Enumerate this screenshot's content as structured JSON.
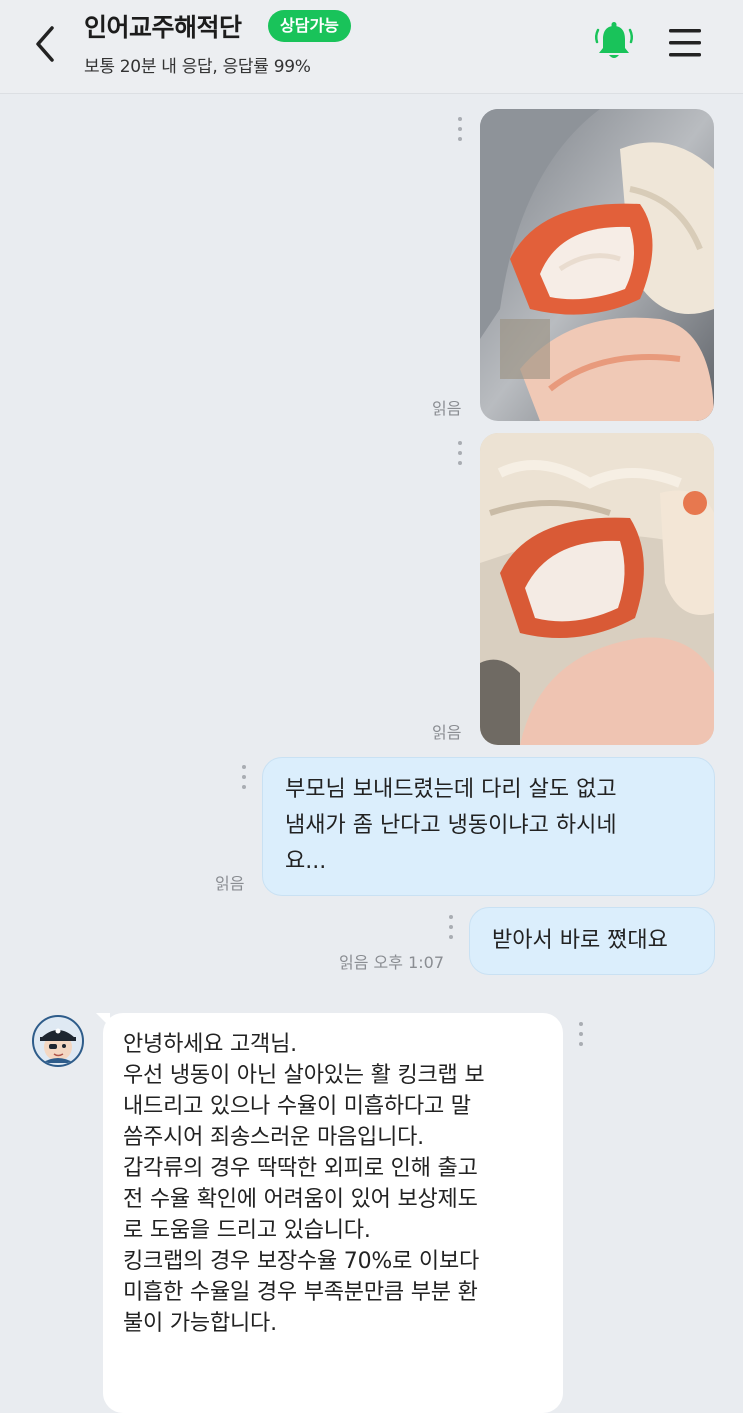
{
  "header": {
    "title": "인어교주해적단",
    "badge": "상담가능",
    "subtitle": "보통 20분 내 응답, 응답률 99%",
    "icons": {
      "back": "chevron-left-icon",
      "bell": "bell-icon",
      "menu": "hamburger-menu-icon"
    },
    "colors": {
      "bell": "#19c35a",
      "badge": "#19c35a"
    }
  },
  "messages": [
    {
      "type": "image",
      "from": "me",
      "read": "읽음",
      "content": "crab-meat-photo"
    },
    {
      "type": "image",
      "from": "me",
      "read": "읽음",
      "content": "crab-meat-photo"
    },
    {
      "type": "text",
      "from": "me",
      "read": "읽음",
      "lines": [
        "부모님 보내드렸는데 다리 살도 없고",
        "냄새가 좀 난다고 냉동이냐고 하시네",
        "요..."
      ]
    },
    {
      "type": "text",
      "from": "me",
      "read": "읽음",
      "time": "오후 1:07",
      "lines": [
        "받아서 바로 쪘대요"
      ]
    },
    {
      "type": "text",
      "from": "seller",
      "lines": [
        "안녕하세요 고객님.",
        "우선 냉동이 아닌 살아있는 활 킹크랩 보",
        "내드리고 있으나 수율이 미흡하다고 말",
        "씀주시어 죄송스러운 마음입니다.",
        "갑각류의 경우 딱딱한 외피로 인해 출고",
        "전 수율 확인에 어려움이 있어 보상제도",
        "로 도움을 드리고 있습니다.",
        "킹크랩의 경우 보장수율 70%로 이보다",
        "미흡한 수율일 경우 부족분만큼 부분 환",
        "불이 가능합니다."
      ]
    }
  ],
  "colors": {
    "my_bubble": "#dbeefc",
    "their_bubble": "#ffffff",
    "background": "#e9ecf0"
  }
}
